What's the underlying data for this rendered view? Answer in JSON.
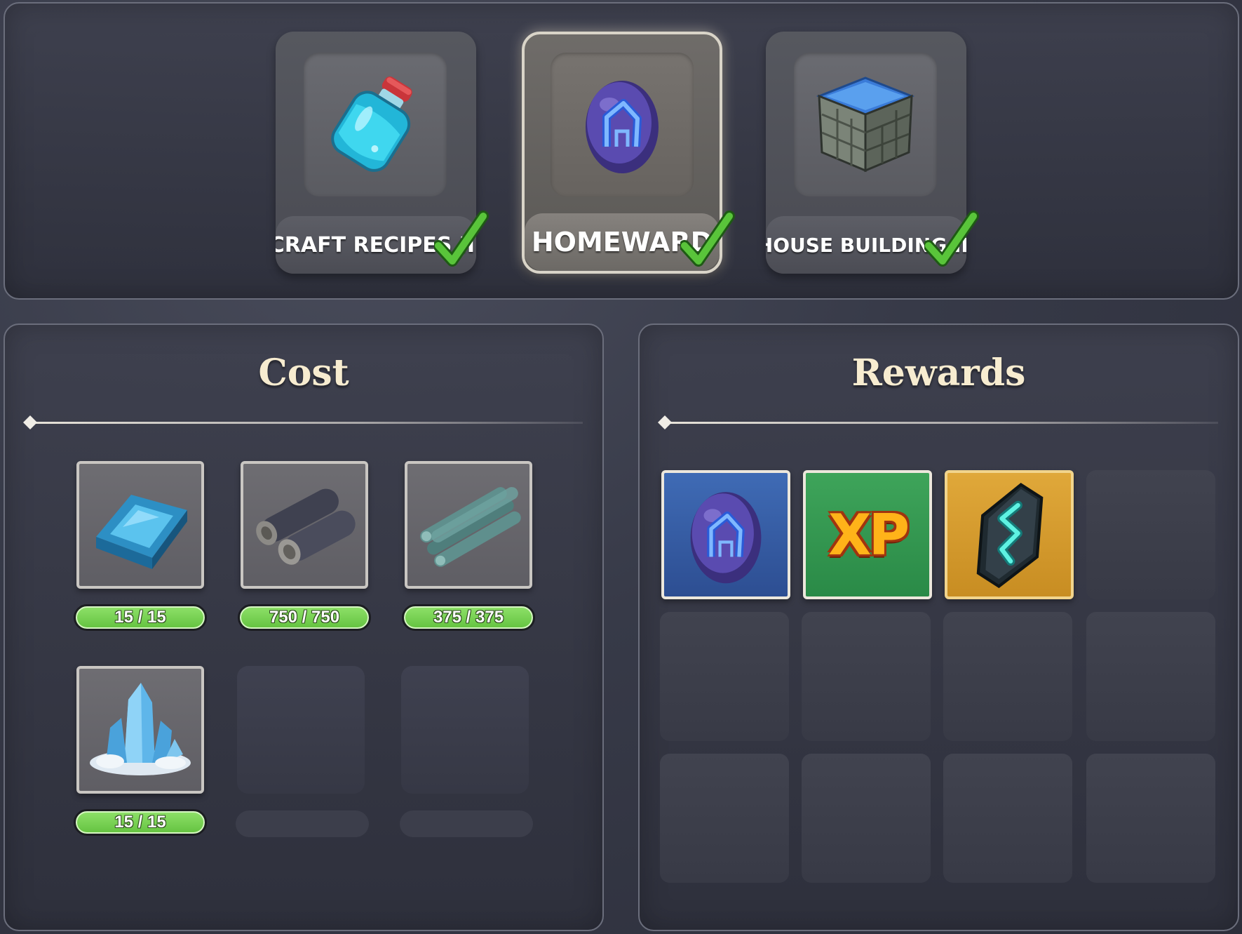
{
  "unlocks": [
    {
      "label": "CRAFT RECIPES III",
      "icon": "potion-bottle-icon",
      "completed": true,
      "selected": false
    },
    {
      "label": "HOMEWARD",
      "icon": "homeward-rune-stone-icon",
      "completed": true,
      "selected": true
    },
    {
      "label": "HOUSE BUILDING III",
      "icon": "stone-block-icon",
      "completed": true,
      "selected": false
    }
  ],
  "cost": {
    "title": "Cost",
    "items": [
      {
        "icon": "blue-ingot-icon",
        "count": "15 / 15"
      },
      {
        "icon": "dark-logs-icon",
        "count": "750 / 750"
      },
      {
        "icon": "teal-planks-icon",
        "count": "375 / 375"
      },
      {
        "icon": "ice-crystal-icon",
        "count": "15 / 15"
      }
    ]
  },
  "rewards": {
    "title": "Rewards",
    "items": [
      {
        "icon": "homeward-rune-stone-icon",
        "color": "#3a64ad"
      },
      {
        "icon": "xp-icon",
        "text": "XP",
        "color": "#35995a"
      },
      {
        "icon": "teal-rune-gem-icon",
        "color": "#d89c2e"
      }
    ]
  },
  "colors": {
    "count_pill_green": "#7ad454",
    "check_green": "#59c43a",
    "title_cream": "#f7ecd0"
  }
}
